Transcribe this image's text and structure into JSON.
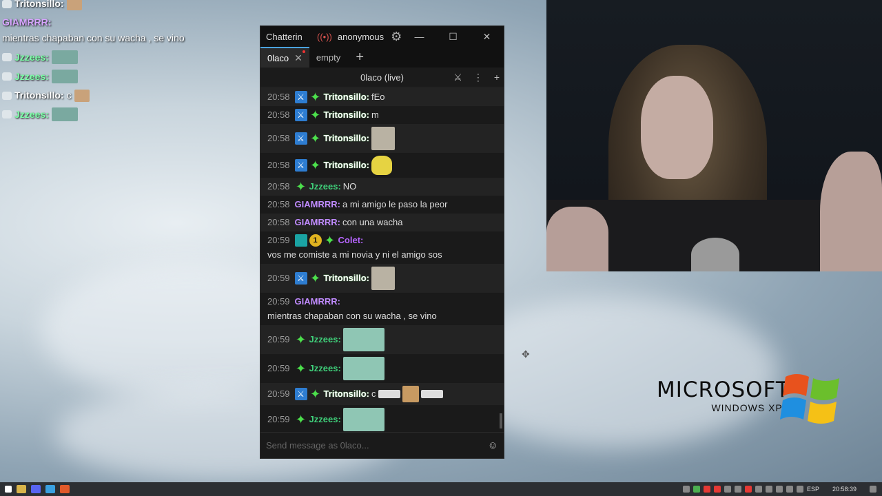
{
  "overlay": {
    "lines": [
      {
        "name": "Tritonsillo:",
        "text": ""
      },
      {
        "name": "GIAMRRR:",
        "text": "mientras chapaban con su wacha , se vino"
      },
      {
        "name": "Jzzees:",
        "text": ""
      },
      {
        "name": "Jzzees:",
        "text": ""
      },
      {
        "name": "Tritonsillo:",
        "text": "c"
      },
      {
        "name": "Jzzees:",
        "text": ""
      }
    ]
  },
  "window": {
    "app_title": "Chatterin",
    "account": "anonymous",
    "tabs": [
      {
        "label": "0laco",
        "active": true
      },
      {
        "label": "empty",
        "active": false
      }
    ],
    "split_title": "0laco (live)",
    "input_placeholder": "Send message as 0laco..."
  },
  "messages": [
    {
      "time": "20:58",
      "user": "Tritonsillo:",
      "text": "fEo"
    },
    {
      "time": "20:58",
      "user": "Tritonsillo:",
      "text": "m"
    },
    {
      "time": "20:58",
      "user": "Tritonsillo:",
      "text": ""
    },
    {
      "time": "20:58",
      "user": "Tritonsillo:",
      "text": ""
    },
    {
      "time": "20:58",
      "user": "Jzzees:",
      "text": "NO"
    },
    {
      "time": "20:58",
      "user": "GIAMRRR:",
      "text": "a mi amigo le paso la peor"
    },
    {
      "time": "20:58",
      "user": "GIAMRRR:",
      "text": "con una wacha"
    },
    {
      "time": "20:59",
      "user": "Colet:",
      "text": "vos me comiste a mi novia y ni el amigo sos",
      "badge_number": "1"
    },
    {
      "time": "20:59",
      "user": "Tritonsillo:",
      "text": ""
    },
    {
      "time": "20:59",
      "user": "GIAMRRR:",
      "text": "mientras chapaban con su wacha , se vino"
    },
    {
      "time": "20:59",
      "user": "Jzzees:",
      "text": ""
    },
    {
      "time": "20:59",
      "user": "Jzzees:",
      "text": ""
    },
    {
      "time": "20:59",
      "user": "Tritonsillo:",
      "text": "c"
    },
    {
      "time": "20:59",
      "user": "Jzzees:",
      "text": ""
    }
  ],
  "xp_logo": {
    "brand": "MICROSOFT",
    "product": "WINDOWS XP"
  },
  "taskbar": {
    "lang": "ESP",
    "clock": "20:58:39"
  },
  "colors": {
    "accent": "#4aa3df",
    "vip": "#4ce04c",
    "mod": "#2e7dd1"
  }
}
